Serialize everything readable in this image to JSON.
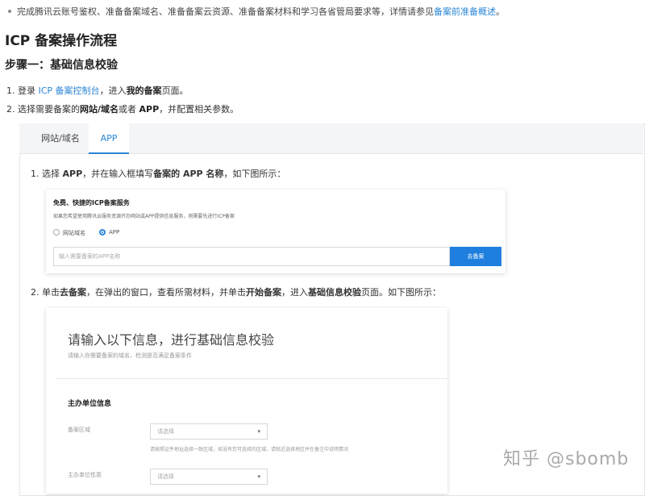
{
  "intro": {
    "text": "完成腾讯云账号鉴权、准备备案域名、准备备案云资源、准备备案材料和学习各省管局要求等，详情请参见",
    "link": "备案前准备概述",
    "end": "。"
  },
  "heading": "ICP 备案操作流程",
  "step_heading": "步骤一：基础信息校验",
  "steps": [
    {
      "num": "1.",
      "pre": "登录",
      "link": "ICP 备案控制台",
      "mid": "，进入",
      "bold": "我的备案",
      "post": "页面。"
    },
    {
      "num": "2.",
      "pre": "选择需要备案的",
      "bold1": "网站/域名",
      "mid": "或者",
      "bold2": "APP",
      "post": "，并配置相关参数。"
    }
  ],
  "tabs": [
    {
      "label": "网站/域名",
      "active": false
    },
    {
      "label": "APP",
      "active": true
    }
  ],
  "substeps": [
    {
      "num": "1.",
      "pre": "选择",
      "bold1": "APP",
      "mid": "，并在输入框填写",
      "bold2": "备案的 APP 名称",
      "post": "，如下图所示："
    },
    {
      "num": "2.",
      "pre": "单击",
      "bold1": "去备案",
      "mid1": "，在弹出的窗口，查看所需材料，并单击",
      "bold2": "开始备案",
      "mid2": "，进入",
      "bold3": "基础信息校验",
      "post": "页面。如下图所示："
    }
  ],
  "card1": {
    "title": "免费、快捷的ICP备案服务",
    "desc": "如果您希望使用腾讯云服务资源开办网站或APP提供信息服务，则需要先进行ICP备案",
    "radio_site": "网站域名",
    "radio_app": "APP",
    "input_placeholder": "输入需要备案的APP名称",
    "button": "去备案"
  },
  "card2": {
    "title": "请输入以下信息，进行基础信息校验",
    "subtitle": "请输入你需要备案的域名，检测是否满足备案条件",
    "section": "主办单位信息",
    "field1_label": "备案区域",
    "field1_value": "请选择",
    "hint": "请按照证件地址选择一致区域，如没有您可选择的区域，请就近选择地区并在备注中说明情况",
    "field2_label": "主办单位性质",
    "field2_value": "请选择"
  },
  "watermark": "知乎 @sbomb",
  "colors": {
    "accent": "#2a86d6",
    "button": "#1f7fde"
  }
}
